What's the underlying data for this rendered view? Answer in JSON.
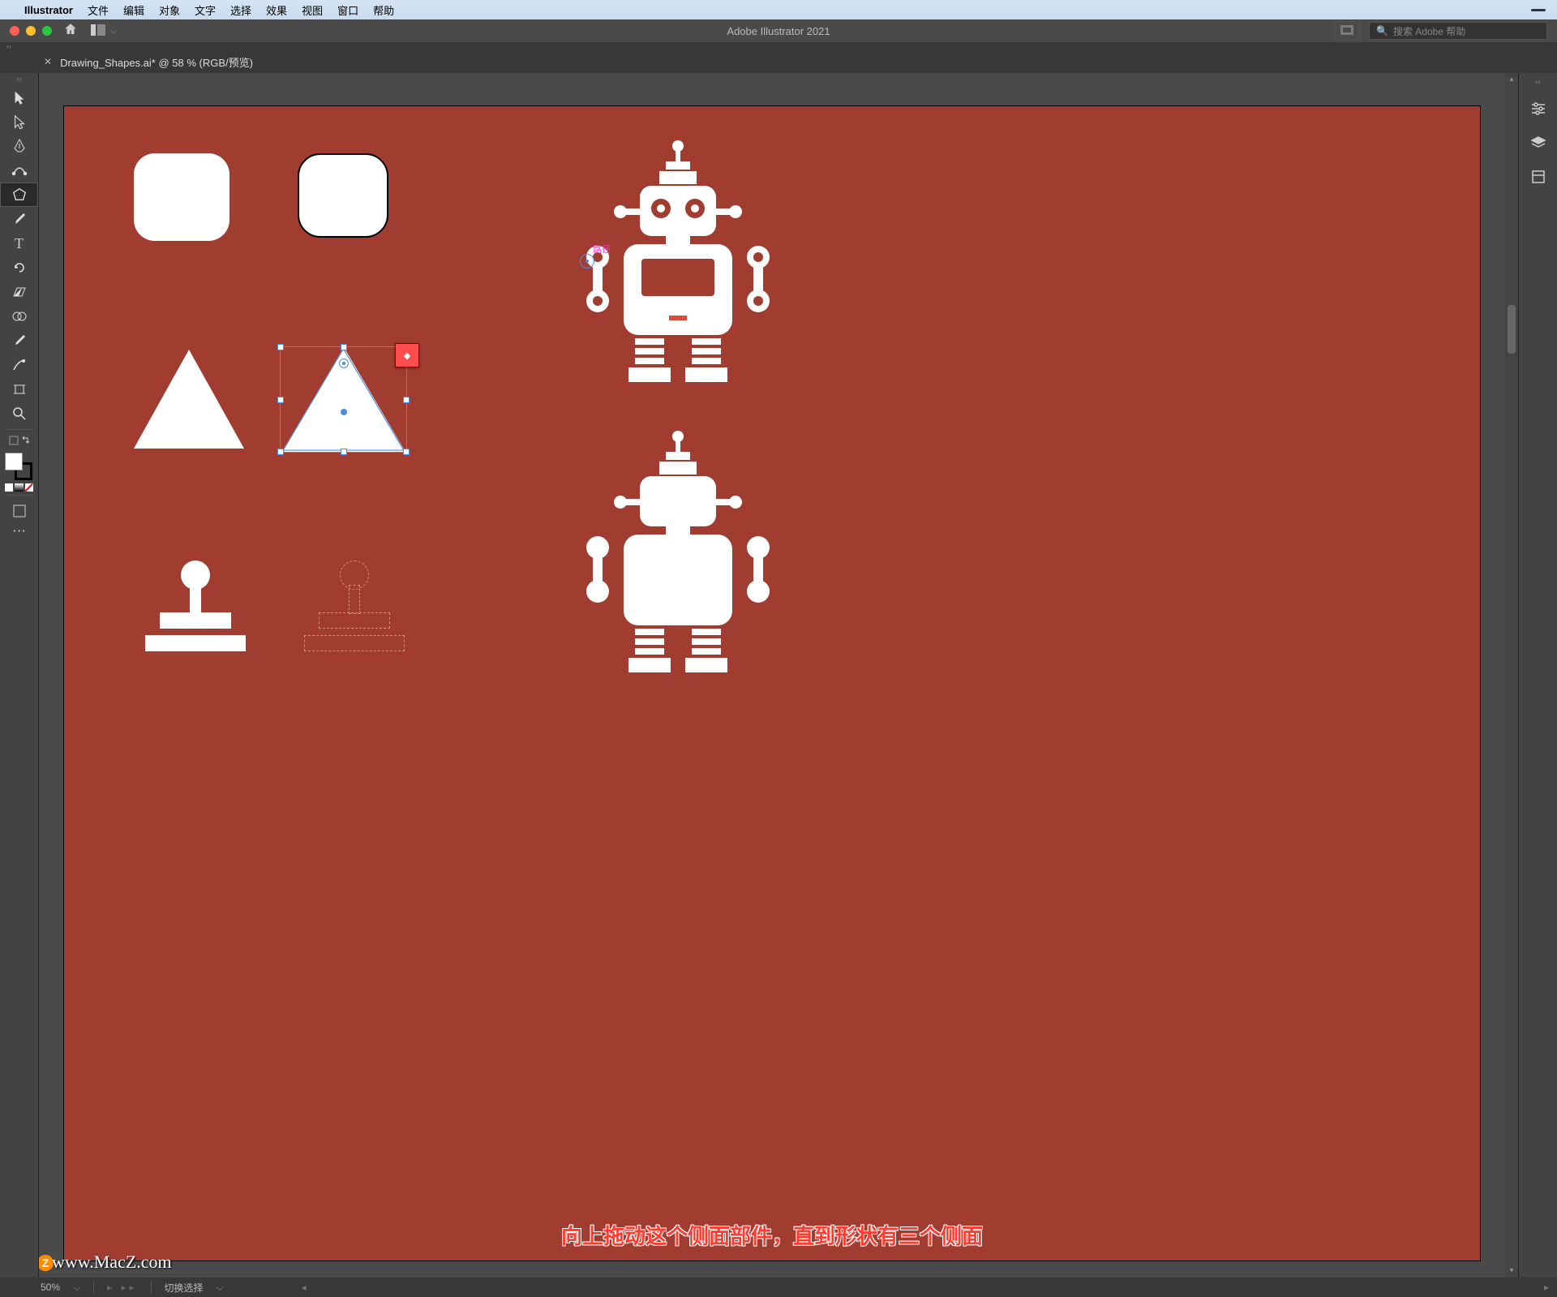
{
  "menubar": {
    "app_name": "Illustrator",
    "items": [
      "文件",
      "编辑",
      "对象",
      "文字",
      "选择",
      "效果",
      "视图",
      "窗口",
      "帮助"
    ]
  },
  "window": {
    "title": "Adobe Illustrator 2021",
    "search_placeholder": "搜索 Adobe 帮助"
  },
  "document": {
    "tab_title": "Drawing_Shapes.ai* @ 58 % (RGB/预览)"
  },
  "canvas": {
    "path_label": "路径",
    "artboard_color": "#a03c30"
  },
  "status": {
    "zoom": "50%",
    "label": "切换选择"
  },
  "instruction": "向上拖动这个侧面部件，直到形状有三个侧面",
  "watermark": "www.MacZ.com"
}
